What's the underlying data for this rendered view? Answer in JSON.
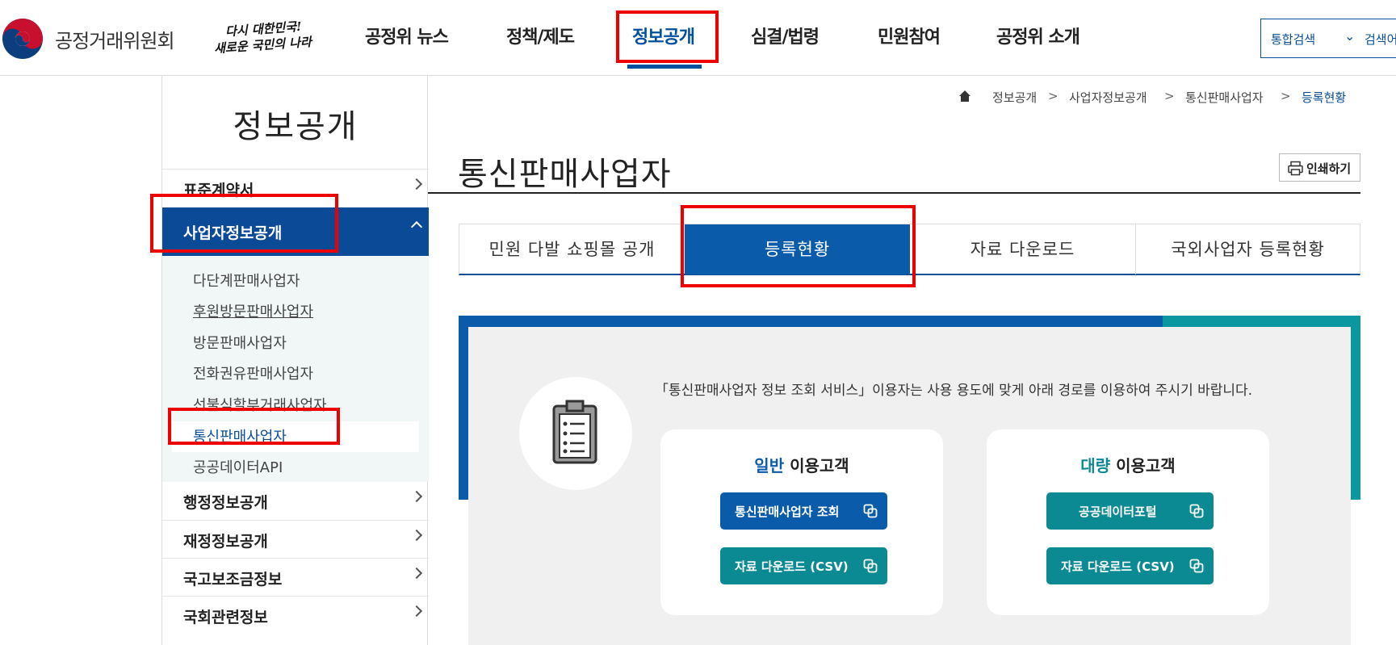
{
  "header": {
    "logo_text": "공정거래위원회",
    "slogan_line1": "다시 대한민국!",
    "slogan_line2": "새로운 국민의 나라",
    "nav": [
      "공정위 뉴스",
      "정책/제도",
      "정보공개",
      "심결/법령",
      "민원참여",
      "공정위 소개"
    ],
    "active_nav": "정보공개",
    "search_select": "통합검색",
    "search_placeholder": "검색어"
  },
  "breadcrumb": [
    "정보공개",
    "사업자정보공개",
    "통신판매사업자",
    "등록현황"
  ],
  "sidebar": {
    "title": "정보공개",
    "items": [
      {
        "label": "표준계약서"
      },
      {
        "label": "사업자정보공개",
        "active": true
      },
      {
        "label": "행정정보공개"
      },
      {
        "label": "재정정보공개"
      },
      {
        "label": "국고보조금정보"
      },
      {
        "label": "국회관련정보"
      }
    ],
    "sub_items": [
      "다단계판매사업자",
      "후원방문판매사업자",
      "방문판매사업자",
      "전화권유판매사업자",
      "선불식할부거래사업자",
      "통신판매사업자",
      "공공데이터API"
    ]
  },
  "page": {
    "title": "통신판매사업자",
    "print_label": "인쇄하기"
  },
  "tabs": [
    {
      "label": "민원 다발 쇼핑몰 공개"
    },
    {
      "label": "등록현황",
      "active": true
    },
    {
      "label": "자료 다운로드"
    },
    {
      "label": "국외사업자 등록현황"
    }
  ],
  "content": {
    "notice": "「통신판매사업자 정보 조회 서비스」이용자는 사용 용도에 맞게 아래 경로를 이용하여 주시기 바랍니다.",
    "card_general": {
      "title_highlight": "일반",
      "title_rest": " 이용고객",
      "btn1": "통신판매사업자 조회",
      "btn2": "자료 다운로드 (CSV)"
    },
    "card_bulk": {
      "title_highlight": "대량",
      "title_rest": " 이용고객",
      "btn1": "공공데이터포털",
      "btn2": "자료 다운로드 (CSV)"
    }
  },
  "colors": {
    "primary": "#0a5cab",
    "teal": "#0b8a93",
    "annotation_red": "#ee0000"
  }
}
